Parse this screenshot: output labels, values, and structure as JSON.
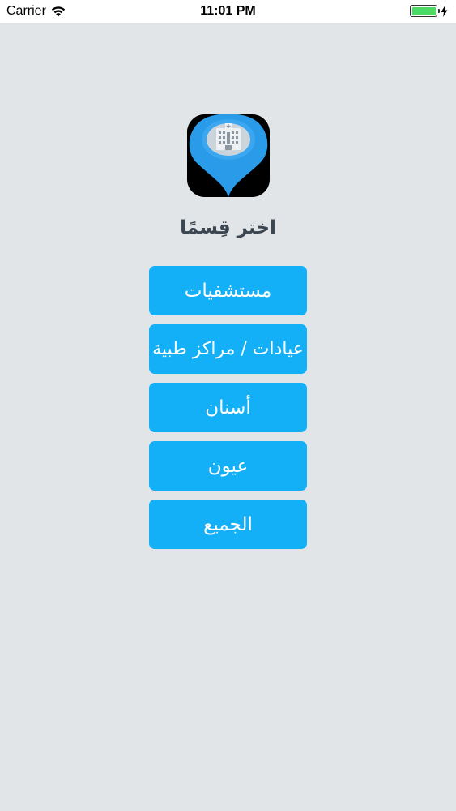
{
  "status_bar": {
    "carrier": "Carrier",
    "time": "11:01 PM",
    "battery_level": 1.0,
    "icons": [
      "wifi-icon",
      "battery-icon",
      "charging-bolt-icon"
    ]
  },
  "app_icon": {
    "name": "hospital-location-pin-icon"
  },
  "title": "اختر قِسمًا",
  "buttons": [
    {
      "label": "مستشفيات"
    },
    {
      "label": "عيادات / مراكز طبية"
    },
    {
      "label": "أسنان"
    },
    {
      "label": "عيون"
    },
    {
      "label": "الجميع"
    }
  ],
  "colors": {
    "background": "#e2e5e8",
    "button": "#13b0f7",
    "button_text": "#ffffff",
    "title": "#3c4651"
  }
}
